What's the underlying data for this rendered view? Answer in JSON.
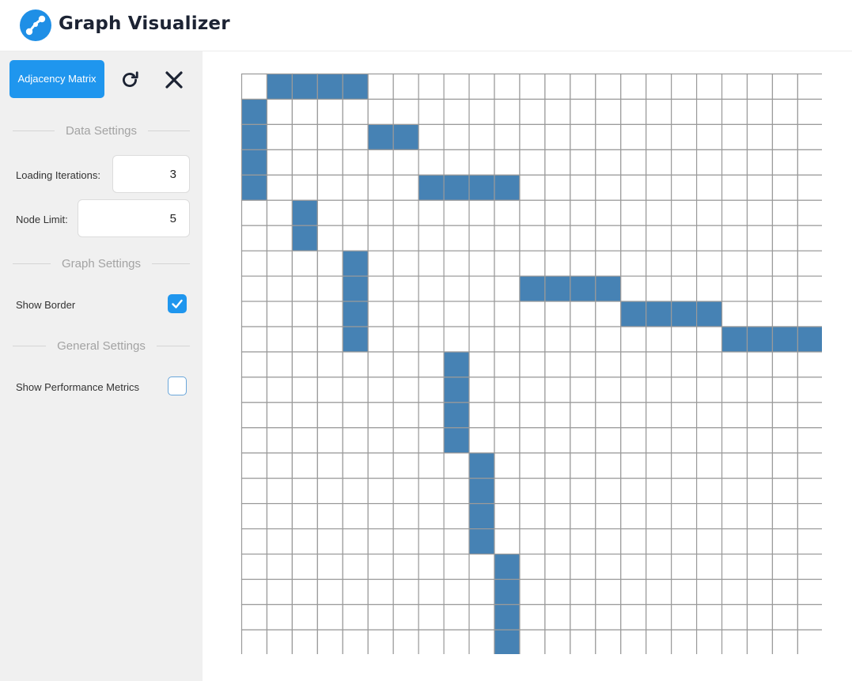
{
  "app": {
    "title": "Graph Visualizer",
    "logo_icon": "graph-logo-icon"
  },
  "toolbar": {
    "mode_label": "Adjacency Matrix",
    "reload_icon": "reload-icon",
    "close_icon": "close-icon"
  },
  "sections": {
    "data": "Data Settings",
    "graph": "Graph Settings",
    "general": "General Settings"
  },
  "settings": {
    "loading_iterations": {
      "label": "Loading Iterations:",
      "value": "3"
    },
    "node_limit": {
      "label": "Node Limit:",
      "value": "5"
    },
    "show_border": {
      "label": "Show Border",
      "checked": true
    },
    "show_metrics": {
      "label": "Show Performance Metrics",
      "checked": false
    }
  },
  "colors": {
    "accent": "#1f96ee",
    "cell_filled": "#4682b4",
    "cell_empty": "#ffffff",
    "grid_line": "#9a9a9a",
    "sidebar_bg": "#f0f0f0"
  },
  "matrix": {
    "size": 23,
    "edges": [
      [
        0,
        1
      ],
      [
        0,
        2
      ],
      [
        0,
        3
      ],
      [
        0,
        4
      ],
      [
        1,
        0
      ],
      [
        2,
        0
      ],
      [
        3,
        0
      ],
      [
        4,
        0
      ],
      [
        2,
        5
      ],
      [
        2,
        6
      ],
      [
        4,
        7
      ],
      [
        4,
        8
      ],
      [
        4,
        9
      ],
      [
        4,
        10
      ],
      [
        5,
        2
      ],
      [
        6,
        2
      ],
      [
        7,
        4
      ],
      [
        8,
        4
      ],
      [
        9,
        4
      ],
      [
        10,
        4
      ],
      [
        8,
        11
      ],
      [
        8,
        12
      ],
      [
        8,
        13
      ],
      [
        8,
        14
      ],
      [
        9,
        15
      ],
      [
        9,
        16
      ],
      [
        9,
        17
      ],
      [
        9,
        18
      ],
      [
        10,
        19
      ],
      [
        10,
        20
      ],
      [
        10,
        21
      ],
      [
        10,
        22
      ],
      [
        11,
        8
      ],
      [
        12,
        8
      ],
      [
        13,
        8
      ],
      [
        14,
        8
      ],
      [
        15,
        9
      ],
      [
        16,
        9
      ],
      [
        17,
        9
      ],
      [
        18,
        9
      ],
      [
        19,
        10
      ],
      [
        20,
        10
      ],
      [
        21,
        10
      ],
      [
        22,
        10
      ]
    ]
  }
}
